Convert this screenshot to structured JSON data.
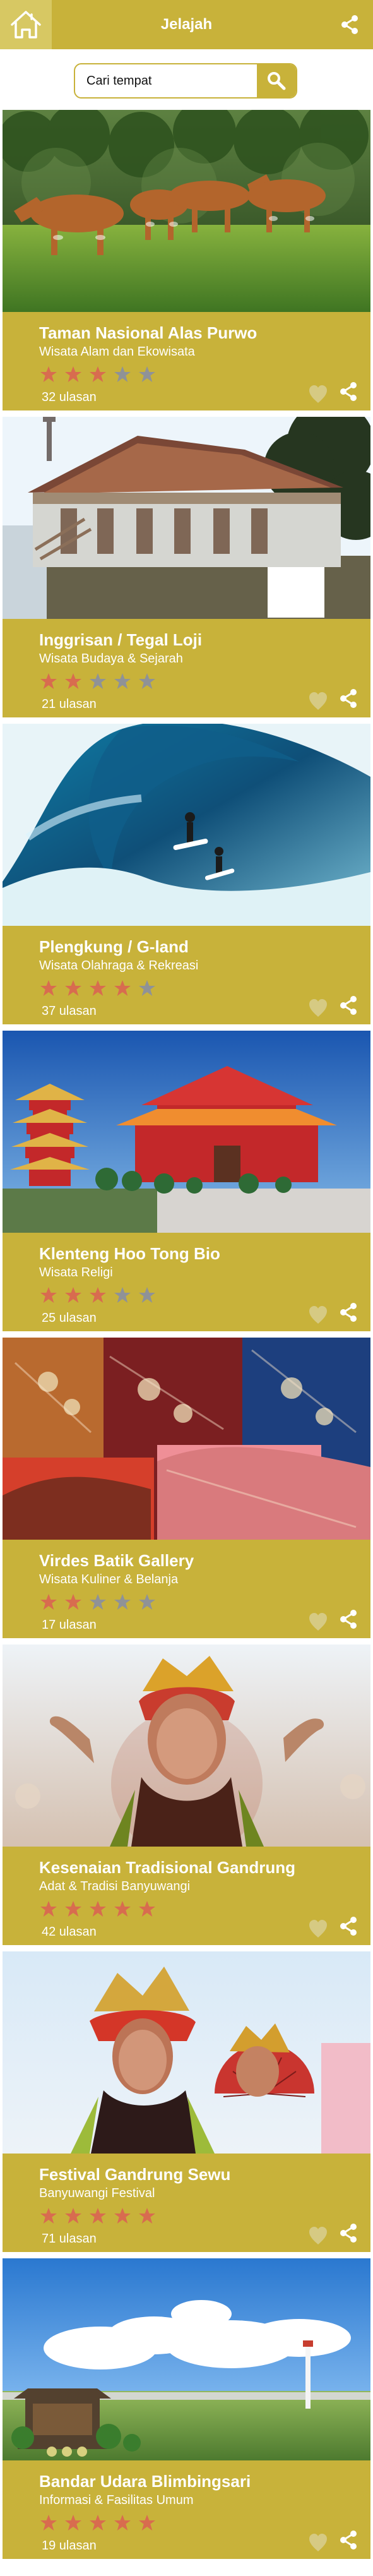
{
  "app": {
    "title": "Jelajah"
  },
  "search": {
    "placeholder": "Cari tempat",
    "value": ""
  },
  "colors": {
    "accent": "#c8b23a",
    "accent_light": "#d7c863",
    "star_active": "#d86c4f",
    "star_inactive": "#8f9297",
    "heart": "#d6ca83",
    "share": "#ffffff"
  },
  "icons": {
    "home": "home-icon",
    "share": "share-icon",
    "search": "search-icon",
    "heart": "heart-icon",
    "star": "star-icon"
  },
  "cards": [
    {
      "title": "Taman Nasional Alas Purwo",
      "category": "Wisata Alam dan Ekowisata",
      "rating": 3,
      "reviews": "32 ulasan",
      "image": "cattle-grassland"
    },
    {
      "title": "Inggrisan / Tegal Loji",
      "category": "Wisata Budaya & Sejarah",
      "rating": 2,
      "reviews": "21 ulasan",
      "image": "colonial-house"
    },
    {
      "title": "Plengkung  / G-land",
      "category": "Wisata Olahraga & Rekreasi",
      "rating": 4,
      "reviews": "37 ulasan",
      "image": "surf-wave"
    },
    {
      "title": "Klenteng Hoo Tong Bio",
      "category": "Wisata Religi",
      "rating": 3,
      "reviews": "25 ulasan",
      "image": "chinese-temple"
    },
    {
      "title": "Virdes Batik Gallery",
      "category": "Wisata Kuliner & Belanja",
      "rating": 2,
      "reviews": "17 ulasan",
      "image": "batik-fabric"
    },
    {
      "title": "Kesenaian Tradisional Gandrung",
      "category": "Adat & Tradisi Banyuwangi",
      "rating": 5,
      "reviews": "42 ulasan",
      "image": "gandrung-dancer"
    },
    {
      "title": "Festival Gandrung Sewu",
      "category": "Banyuwangi Festival",
      "rating": 5,
      "reviews": "71 ulasan",
      "image": "festival-dancers"
    },
    {
      "title": "Bandar Udara Blimbingsari",
      "category": "Informasi & Fasilitas Umum",
      "rating": 5,
      "reviews": "19 ulasan",
      "image": "airport-sign"
    }
  ]
}
